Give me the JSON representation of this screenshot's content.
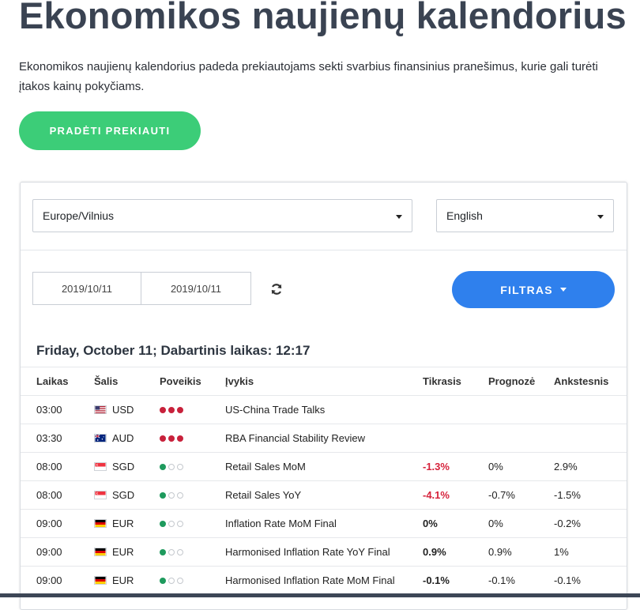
{
  "page": {
    "title": "Ekonomikos naujienų kalendorius",
    "intro": "Ekonomikos naujienų kalendorius padeda prekiautojams sekti svarbius finansinius pranešimus, kurie gali turėti įtakos kainų pokyčiams.",
    "cta_label": "PRADĖTI PREKIAUTI"
  },
  "filters": {
    "timezone": "Europe/Vilnius",
    "language": "English",
    "date_from": "2019/10/11",
    "date_to": "2019/10/11",
    "filter_label": "FILTRAS"
  },
  "calendar": {
    "day_heading": "Friday, October 11; Dabartinis laikas: 12:17",
    "columns": {
      "time": "Laikas",
      "country": "Šalis",
      "impact": "Poveikis",
      "event": "Įvykis",
      "actual": "Tikrasis",
      "forecast": "Prognozė",
      "previous": "Ankstesnis"
    },
    "rows": [
      {
        "time": "03:00",
        "currency": "USD",
        "flag": "us-flag",
        "impact": 3,
        "event": "US-China Trade Talks",
        "actual": "",
        "actual_style": "",
        "forecast": "",
        "previous": ""
      },
      {
        "time": "03:30",
        "currency": "AUD",
        "flag": "au-flag",
        "impact": 3,
        "event": "RBA Financial Stability Review",
        "actual": "",
        "actual_style": "",
        "forecast": "",
        "previous": ""
      },
      {
        "time": "08:00",
        "currency": "SGD",
        "flag": "sg-flag",
        "impact": 1,
        "event": "Retail Sales MoM",
        "actual": "-1.3%",
        "actual_style": "neg",
        "forecast": "0%",
        "previous": "2.9%"
      },
      {
        "time": "08:00",
        "currency": "SGD",
        "flag": "sg-flag",
        "impact": 1,
        "event": "Retail Sales YoY",
        "actual": "-4.1%",
        "actual_style": "neg",
        "forecast": "-0.7%",
        "previous": "-1.5%"
      },
      {
        "time": "09:00",
        "currency": "EUR",
        "flag": "de-flag",
        "impact": 1,
        "event": "Inflation Rate MoM Final",
        "actual": "0%",
        "actual_style": "bold",
        "forecast": "0%",
        "previous": "-0.2%"
      },
      {
        "time": "09:00",
        "currency": "EUR",
        "flag": "de-flag",
        "impact": 1,
        "event": "Harmonised Inflation Rate YoY Final",
        "actual": "0.9%",
        "actual_style": "bold",
        "forecast": "0.9%",
        "previous": "1%"
      },
      {
        "time": "09:00",
        "currency": "EUR",
        "flag": "de-flag",
        "impact": 1,
        "event": "Harmonised Inflation Rate MoM Final",
        "actual": "-0.1%",
        "actual_style": "bold",
        "forecast": "-0.1%",
        "previous": "-0.1%"
      }
    ]
  },
  "colors": {
    "cta": "#3ccd78",
    "filter_button": "#2f80ed",
    "negative": "#d6223b",
    "impact_high": "#c8213b",
    "impact_low": "#1e9a5d"
  }
}
